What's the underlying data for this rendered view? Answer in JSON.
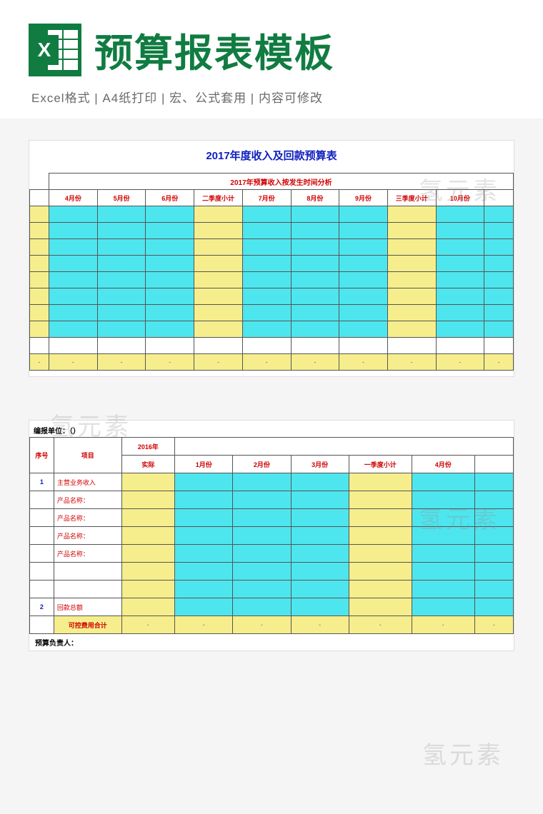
{
  "header": {
    "title": "预算报表模板",
    "subtitle": "Excel格式 |  A4纸打印 | 宏、公式套用 | 内容可修改"
  },
  "watermark": "氢元素",
  "sheet1": {
    "title": "2017年度收入及回款预算表",
    "band": "2017年预算收入按发生时间分析",
    "cols": [
      "4月份",
      "5月份",
      "6月份",
      "二季度小计",
      "7月份",
      "8月份",
      "9月份",
      "三季度小计",
      "10月份",
      ""
    ],
    "dash": "-"
  },
  "sheet2": {
    "unit": "编报单位：（）",
    "col_seq": "序号",
    "col_item": "项目",
    "col_prev": "2016年",
    "col_actual": "实际",
    "months": [
      "1月份",
      "2月份",
      "3月份",
      "一季度小计",
      "4月份",
      ""
    ],
    "rows": {
      "r1_idx": "1",
      "r1_name": "主营业务收入",
      "prod": "产品名称：",
      "r2_idx": "2",
      "r2_name": "回款总额",
      "sum": "可控费用合计"
    },
    "footer": "预算负责人：",
    "dash": "-"
  }
}
